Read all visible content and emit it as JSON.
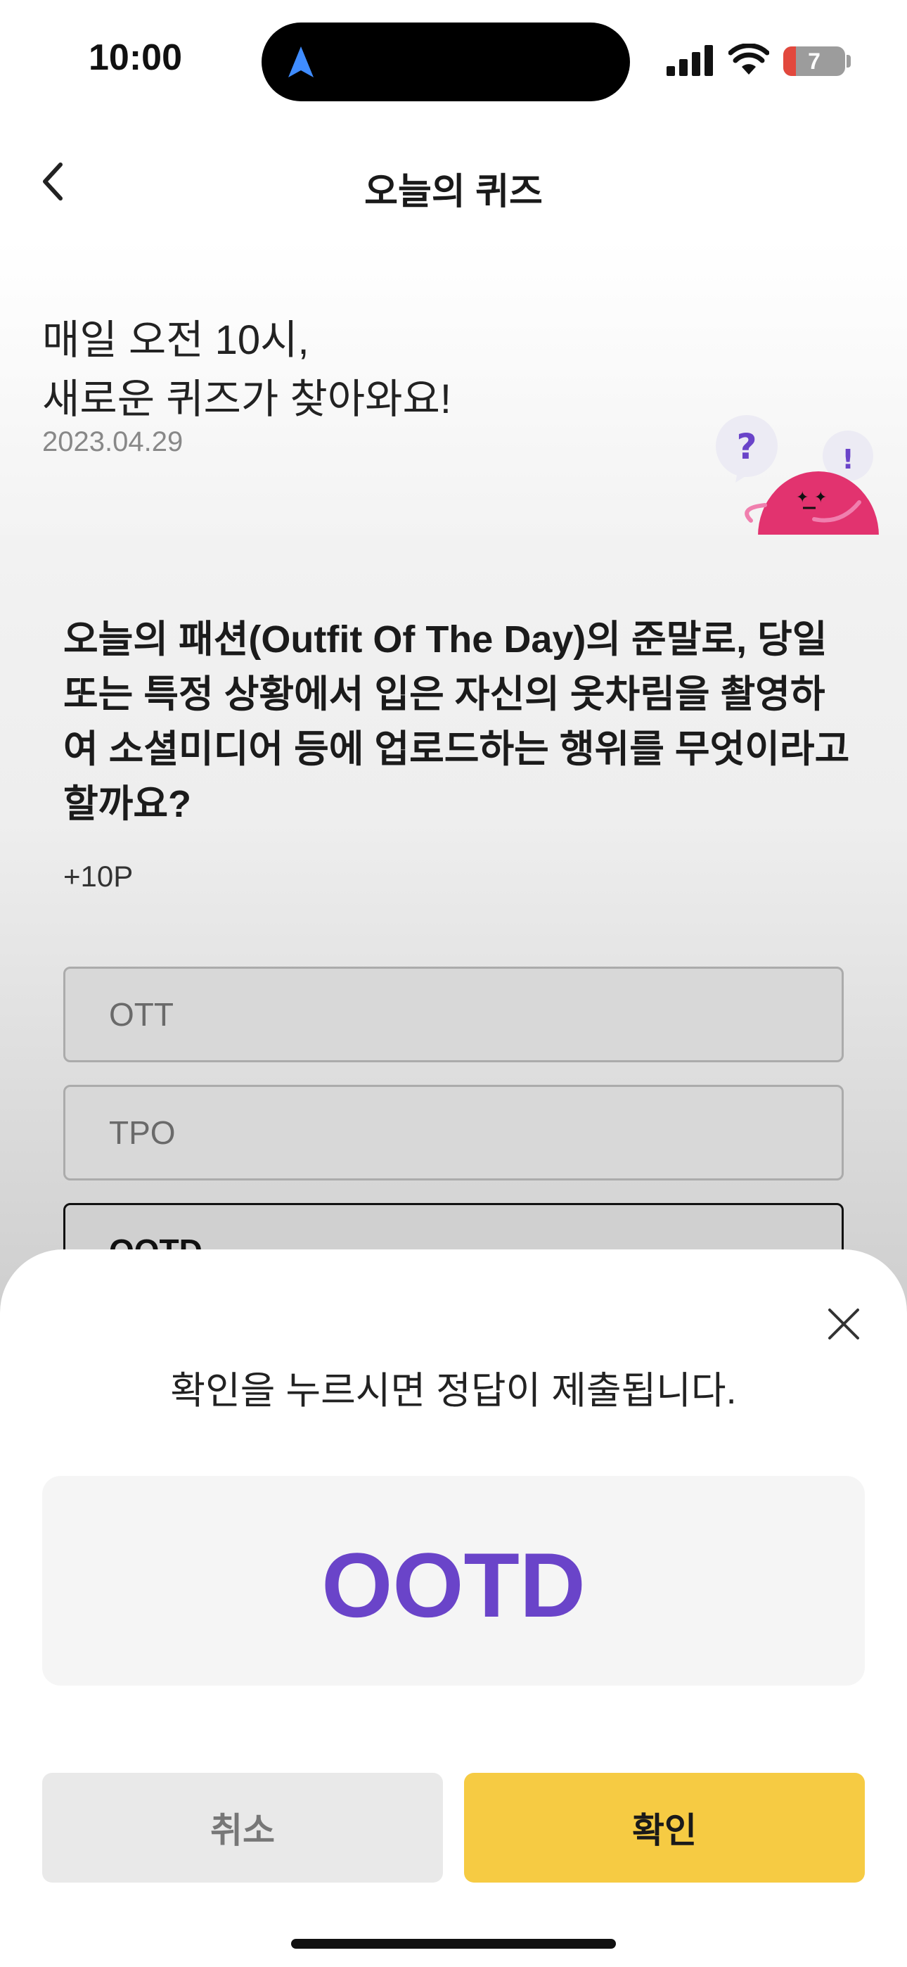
{
  "status_bar": {
    "time": "10:00",
    "battery_level": "7",
    "icons": [
      "location-arrow-icon",
      "signal-icon",
      "wifi-icon",
      "battery-icon"
    ]
  },
  "header": {
    "title": "오늘의 퀴즈",
    "back_icon": "chevron-left-icon"
  },
  "hero": {
    "line1": "매일 오전 10시,",
    "line2": "새로운 퀴즈가 찾아와요!",
    "date": "2023.04.29"
  },
  "quiz": {
    "question": "오늘의 패션(Outfit Of The Day)의 준말로, 당일 또는 특정 상황에서 입은 자신의 옷차림을 촬영하여 소셜미디어 등에 업로드하는 행위를 무엇이라고 할까요?",
    "points": "+10P",
    "options": [
      "OTT",
      "TPO",
      "OOTD"
    ],
    "selected": "OOTD"
  },
  "sheet": {
    "message": "확인을 누르시면 정답이 제출됩니다.",
    "answer": "OOTD",
    "cancel_label": "취소",
    "confirm_label": "확인"
  },
  "colors": {
    "accent": "#6a44c9",
    "confirm_button": "#f6cb43",
    "mascot": "#e2336f"
  }
}
